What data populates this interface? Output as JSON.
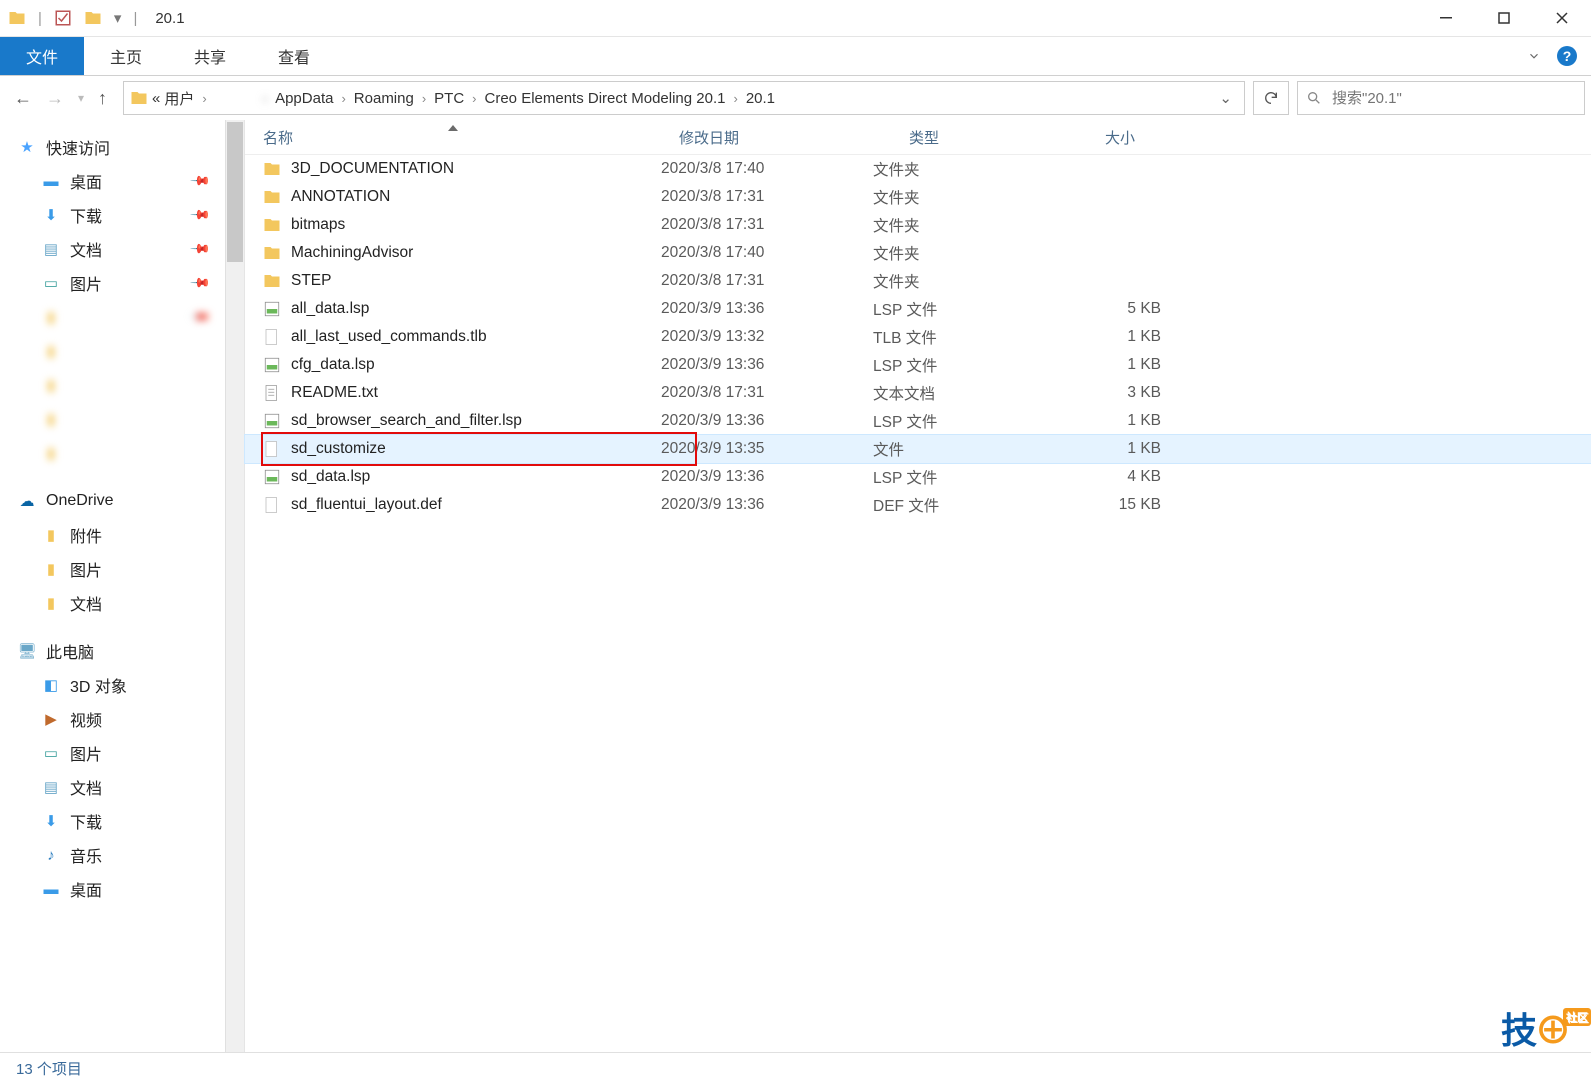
{
  "title": "20.1",
  "ribbon": {
    "file": "文件",
    "home": "主页",
    "share": "共享",
    "view": "查看"
  },
  "breadcrumb": {
    "prefix": "«",
    "items": [
      "用户",
      "",
      "AppData",
      "Roaming",
      "PTC",
      "Creo Elements Direct Modeling 20.1",
      "20.1"
    ]
  },
  "search": {
    "placeholder": "搜索\"20.1\""
  },
  "sidebar": {
    "quick_access": "快速访问",
    "desktop": "桌面",
    "downloads": "下载",
    "documents": "文档",
    "pictures": "图片",
    "onedrive": "OneDrive",
    "od_attach": "附件",
    "od_pictures": "图片",
    "od_documents": "文档",
    "thispc": "此电脑",
    "pc_3d": "3D 对象",
    "pc_video": "视频",
    "pc_pictures": "图片",
    "pc_documents": "文档",
    "pc_downloads": "下载",
    "pc_music": "音乐",
    "pc_desktop": "桌面"
  },
  "columns": {
    "name": "名称",
    "date": "修改日期",
    "type": "类型",
    "size": "大小"
  },
  "rows": [
    {
      "icon": "folder",
      "name": "3D_DOCUMENTATION",
      "date": "2020/3/8 17:40",
      "type": "文件夹",
      "size": ""
    },
    {
      "icon": "folder",
      "name": "ANNOTATION",
      "date": "2020/3/8 17:31",
      "type": "文件夹",
      "size": ""
    },
    {
      "icon": "folder",
      "name": "bitmaps",
      "date": "2020/3/8 17:31",
      "type": "文件夹",
      "size": ""
    },
    {
      "icon": "folder",
      "name": "MachiningAdvisor",
      "date": "2020/3/8 17:40",
      "type": "文件夹",
      "size": ""
    },
    {
      "icon": "folder",
      "name": "STEP",
      "date": "2020/3/8 17:31",
      "type": "文件夹",
      "size": ""
    },
    {
      "icon": "lsp",
      "name": "all_data.lsp",
      "date": "2020/3/9 13:36",
      "type": "LSP 文件",
      "size": "5 KB"
    },
    {
      "icon": "file",
      "name": "all_last_used_commands.tlb",
      "date": "2020/3/9 13:32",
      "type": "TLB 文件",
      "size": "1 KB"
    },
    {
      "icon": "lsp",
      "name": "cfg_data.lsp",
      "date": "2020/3/9 13:36",
      "type": "LSP 文件",
      "size": "1 KB"
    },
    {
      "icon": "txt",
      "name": "README.txt",
      "date": "2020/3/8 17:31",
      "type": "文本文档",
      "size": "3 KB"
    },
    {
      "icon": "lsp",
      "name": "sd_browser_search_and_filter.lsp",
      "date": "2020/3/9 13:36",
      "type": "LSP 文件",
      "size": "1 KB"
    },
    {
      "icon": "file",
      "name": "sd_customize",
      "date": "2020/3/9 13:35",
      "type": "文件",
      "size": "1 KB",
      "selected": true,
      "boxed": true
    },
    {
      "icon": "lsp",
      "name": "sd_data.lsp",
      "date": "2020/3/9 13:36",
      "type": "LSP 文件",
      "size": "4 KB"
    },
    {
      "icon": "file",
      "name": "sd_fluentui_layout.def",
      "date": "2020/3/9 13:36",
      "type": "DEF 文件",
      "size": "15 KB"
    }
  ],
  "status": "13 个项目",
  "watermark": "技"
}
